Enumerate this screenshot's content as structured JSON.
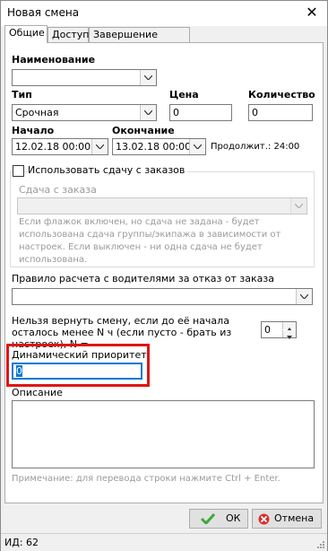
{
  "window": {
    "title": "Новая смена"
  },
  "tabs": [
    {
      "label": "Общие",
      "active": true
    },
    {
      "label": "Доступ",
      "active": false
    },
    {
      "label": "Завершение смены",
      "active": false
    }
  ],
  "form": {
    "name_label": "Наименование",
    "name_value": "",
    "type_label": "Тип",
    "type_value": "Срочная",
    "price_label": "Цена",
    "price_value": "0",
    "qty_label": "Количество",
    "qty_value": "0",
    "start_label": "Начало",
    "start_value": "12.02.18 00:00",
    "end_label": "Окончание",
    "end_value": "13.02.18 00:00",
    "duration_text": "Продолжит.: 24:00",
    "use_orders_label": "Использовать сдачу с заказов",
    "use_orders_checked": false,
    "order_payout_label": "Сдача с заказа",
    "order_payout_value": "",
    "order_payout_help": "Если флажок включен, но сдача не задана - будет использована сдача группы/экипажа в зависимости от настроек. Если выключен - ни одна сдача не будет использована.",
    "driver_rule_label": "Правило расчета с водителями за отказ от заказа",
    "driver_rule_value": "",
    "return_label": "Нельзя вернуть смену, если до её начала осталось менее N ч (если пусто - брать из настроек), N =",
    "return_value": "0",
    "priority_label": "Динамический приоритет",
    "priority_value": "0",
    "description_label": "Описание",
    "description_value": "",
    "note": "Примечание: для перевода строки нажмите Ctrl + Enter."
  },
  "buttons": {
    "ok_label": "ОК",
    "cancel_label": "Отмена"
  },
  "status": {
    "id_text": "ИД: 62"
  },
  "colors": {
    "highlight": "#e01414",
    "ok_icon": "#3ca83c",
    "cancel_icon": "#d83030"
  }
}
